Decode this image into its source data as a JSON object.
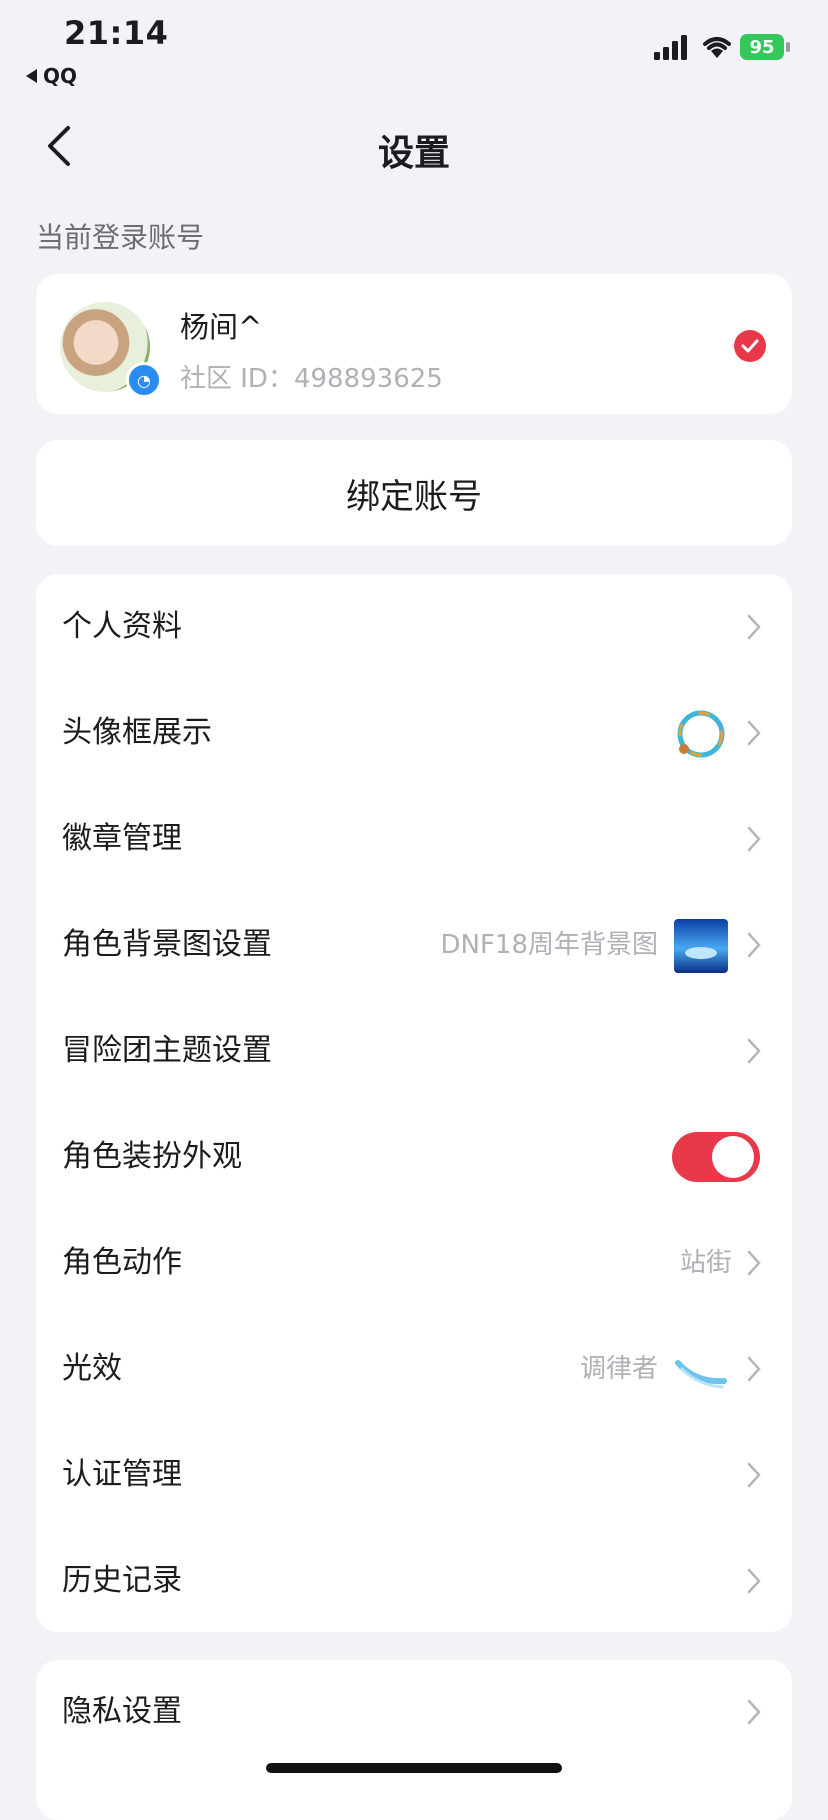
{
  "status_bar": {
    "time": "21:14",
    "back_app": "QQ",
    "battery": "95"
  },
  "nav": {
    "title": "设置"
  },
  "account": {
    "section_label": "当前登录账号",
    "name": "杨间^",
    "id_text": "社区 ID：498893625"
  },
  "bind": {
    "label": "绑定账号"
  },
  "list": {
    "profile": "个人资料",
    "avatar_frame": "头像框展示",
    "badges": "徽章管理",
    "role_bg": "角色背景图设置",
    "role_bg_value": "DNF18周年背景图",
    "adventure_theme": "冒险团主题设置",
    "role_outfit": "角色装扮外观",
    "role_action": "角色动作",
    "role_action_value": "站街",
    "light_effect": "光效",
    "light_effect_value": "调律者",
    "verification": "认证管理",
    "history": "历史记录"
  },
  "toggle_on": true,
  "privacy": {
    "label": "隐私设置"
  },
  "colors": {
    "accent": "#e8394b",
    "background": "#f2f3f7",
    "battery": "#34c759"
  }
}
